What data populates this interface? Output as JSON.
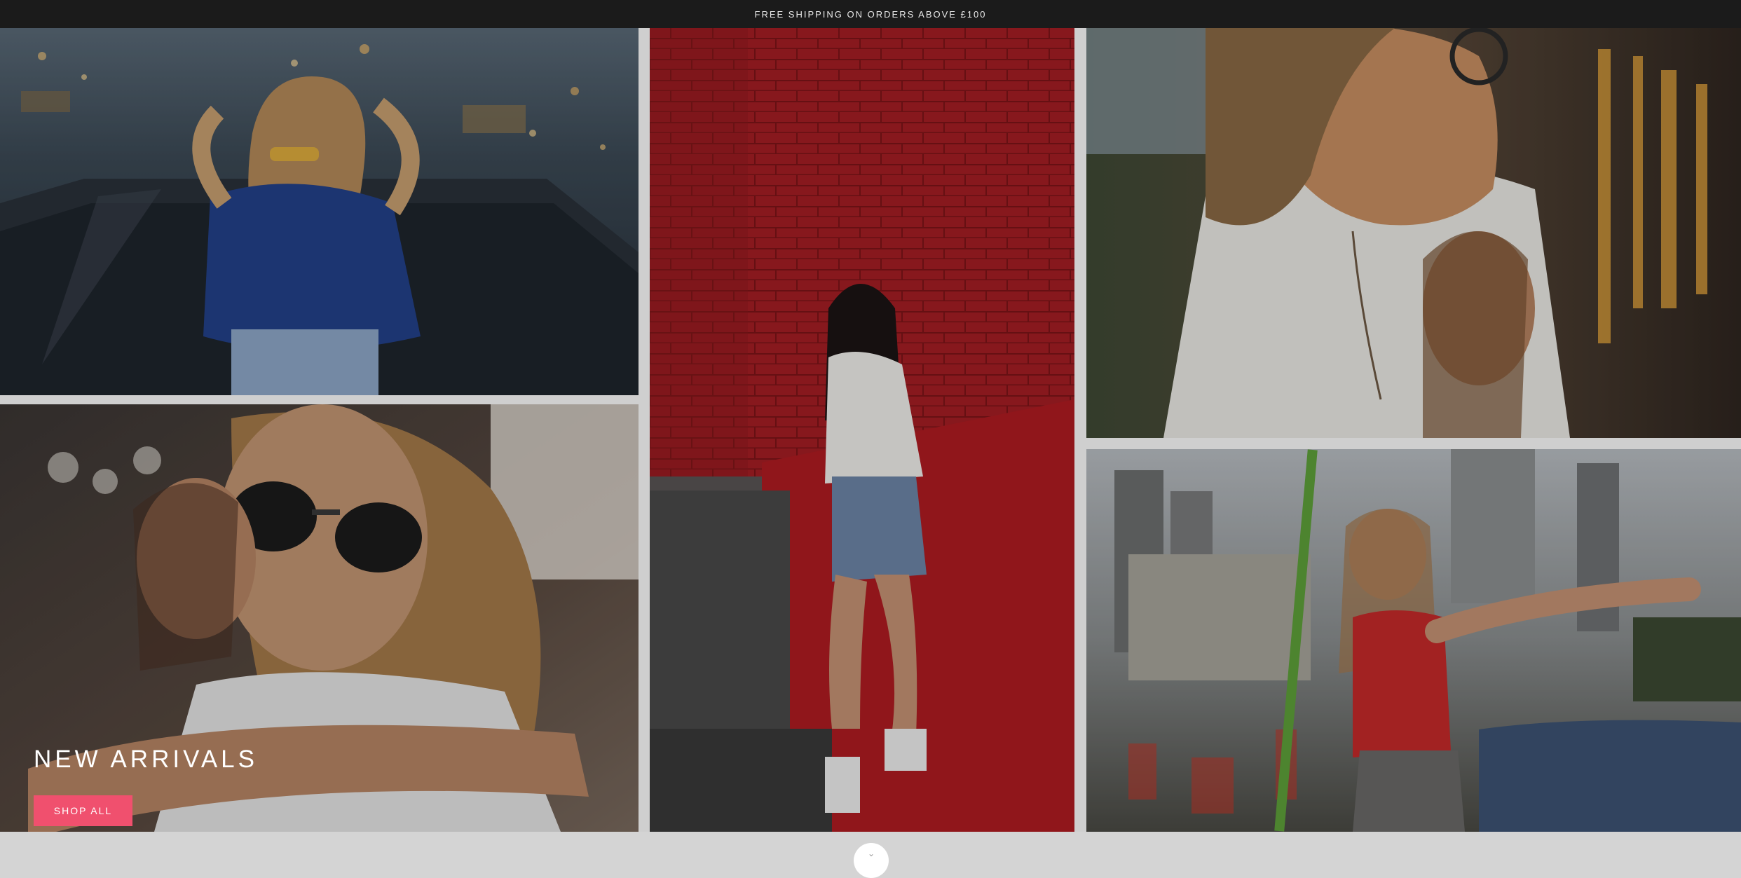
{
  "announcement": {
    "text": "FREE SHIPPING ON ORDERS ABOVE £100"
  },
  "hero": {
    "heading": "NEW ARRIVALS",
    "button_label": "SHOP ALL"
  },
  "colors": {
    "announcement_bg": "#1b1b1b",
    "button_bg": "#f0506e",
    "button_text": "#ffffff",
    "grid_gutter": "#cfcfcf"
  },
  "gallery": [
    {
      "id": "photo-woman-ferris-wheel",
      "icon": "photo"
    },
    {
      "id": "photo-couple-sunglasses",
      "icon": "photo"
    },
    {
      "id": "photo-woman-red-brick-wall",
      "icon": "photo"
    },
    {
      "id": "photo-man-white-shirt-sunset",
      "icon": "photo"
    },
    {
      "id": "photo-woman-red-top-ride",
      "icon": "photo"
    }
  ],
  "scroll_indicator": {
    "icon": "chevron-down-icon"
  }
}
